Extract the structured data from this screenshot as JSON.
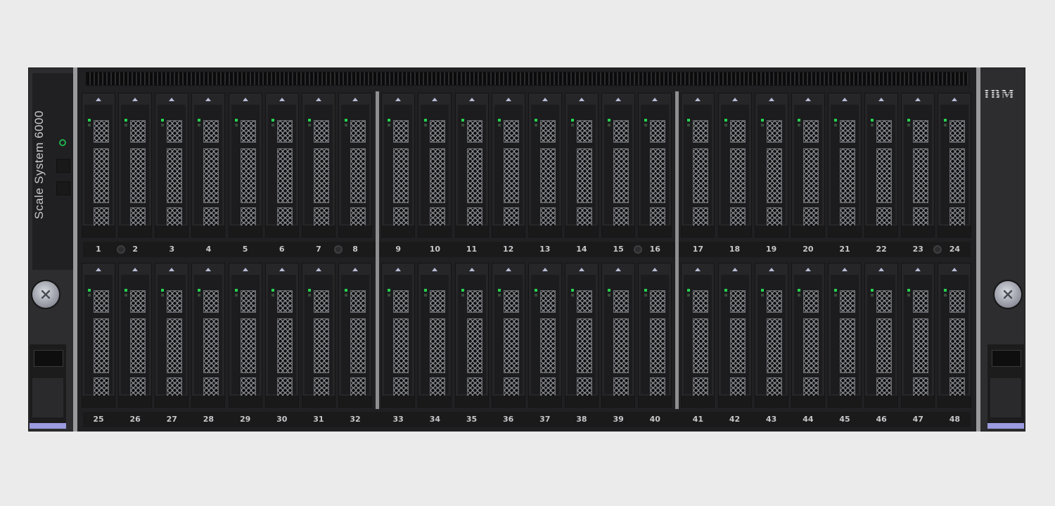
{
  "device": {
    "model_label": "Scale System 6000",
    "brand": "IBM",
    "accent_led_color": "#25d24f",
    "power_led_color": "#1fae4b",
    "handle_accent_color": "#9b9be0"
  },
  "bays": {
    "top_row": [
      "1",
      "2",
      "3",
      "4",
      "5",
      "6",
      "7",
      "8",
      "9",
      "10",
      "11",
      "12",
      "13",
      "14",
      "15",
      "16",
      "17",
      "18",
      "19",
      "20",
      "21",
      "22",
      "23",
      "24"
    ],
    "bottom_row": [
      "25",
      "26",
      "27",
      "28",
      "29",
      "30",
      "31",
      "32",
      "33",
      "34",
      "35",
      "36",
      "37",
      "38",
      "39",
      "40",
      "41",
      "42",
      "43",
      "44",
      "45",
      "46",
      "47",
      "48"
    ]
  },
  "icons": {
    "power": "power-icon",
    "screw": "thumbscrew-icon",
    "bay_arrow": "triangle-up-icon"
  }
}
